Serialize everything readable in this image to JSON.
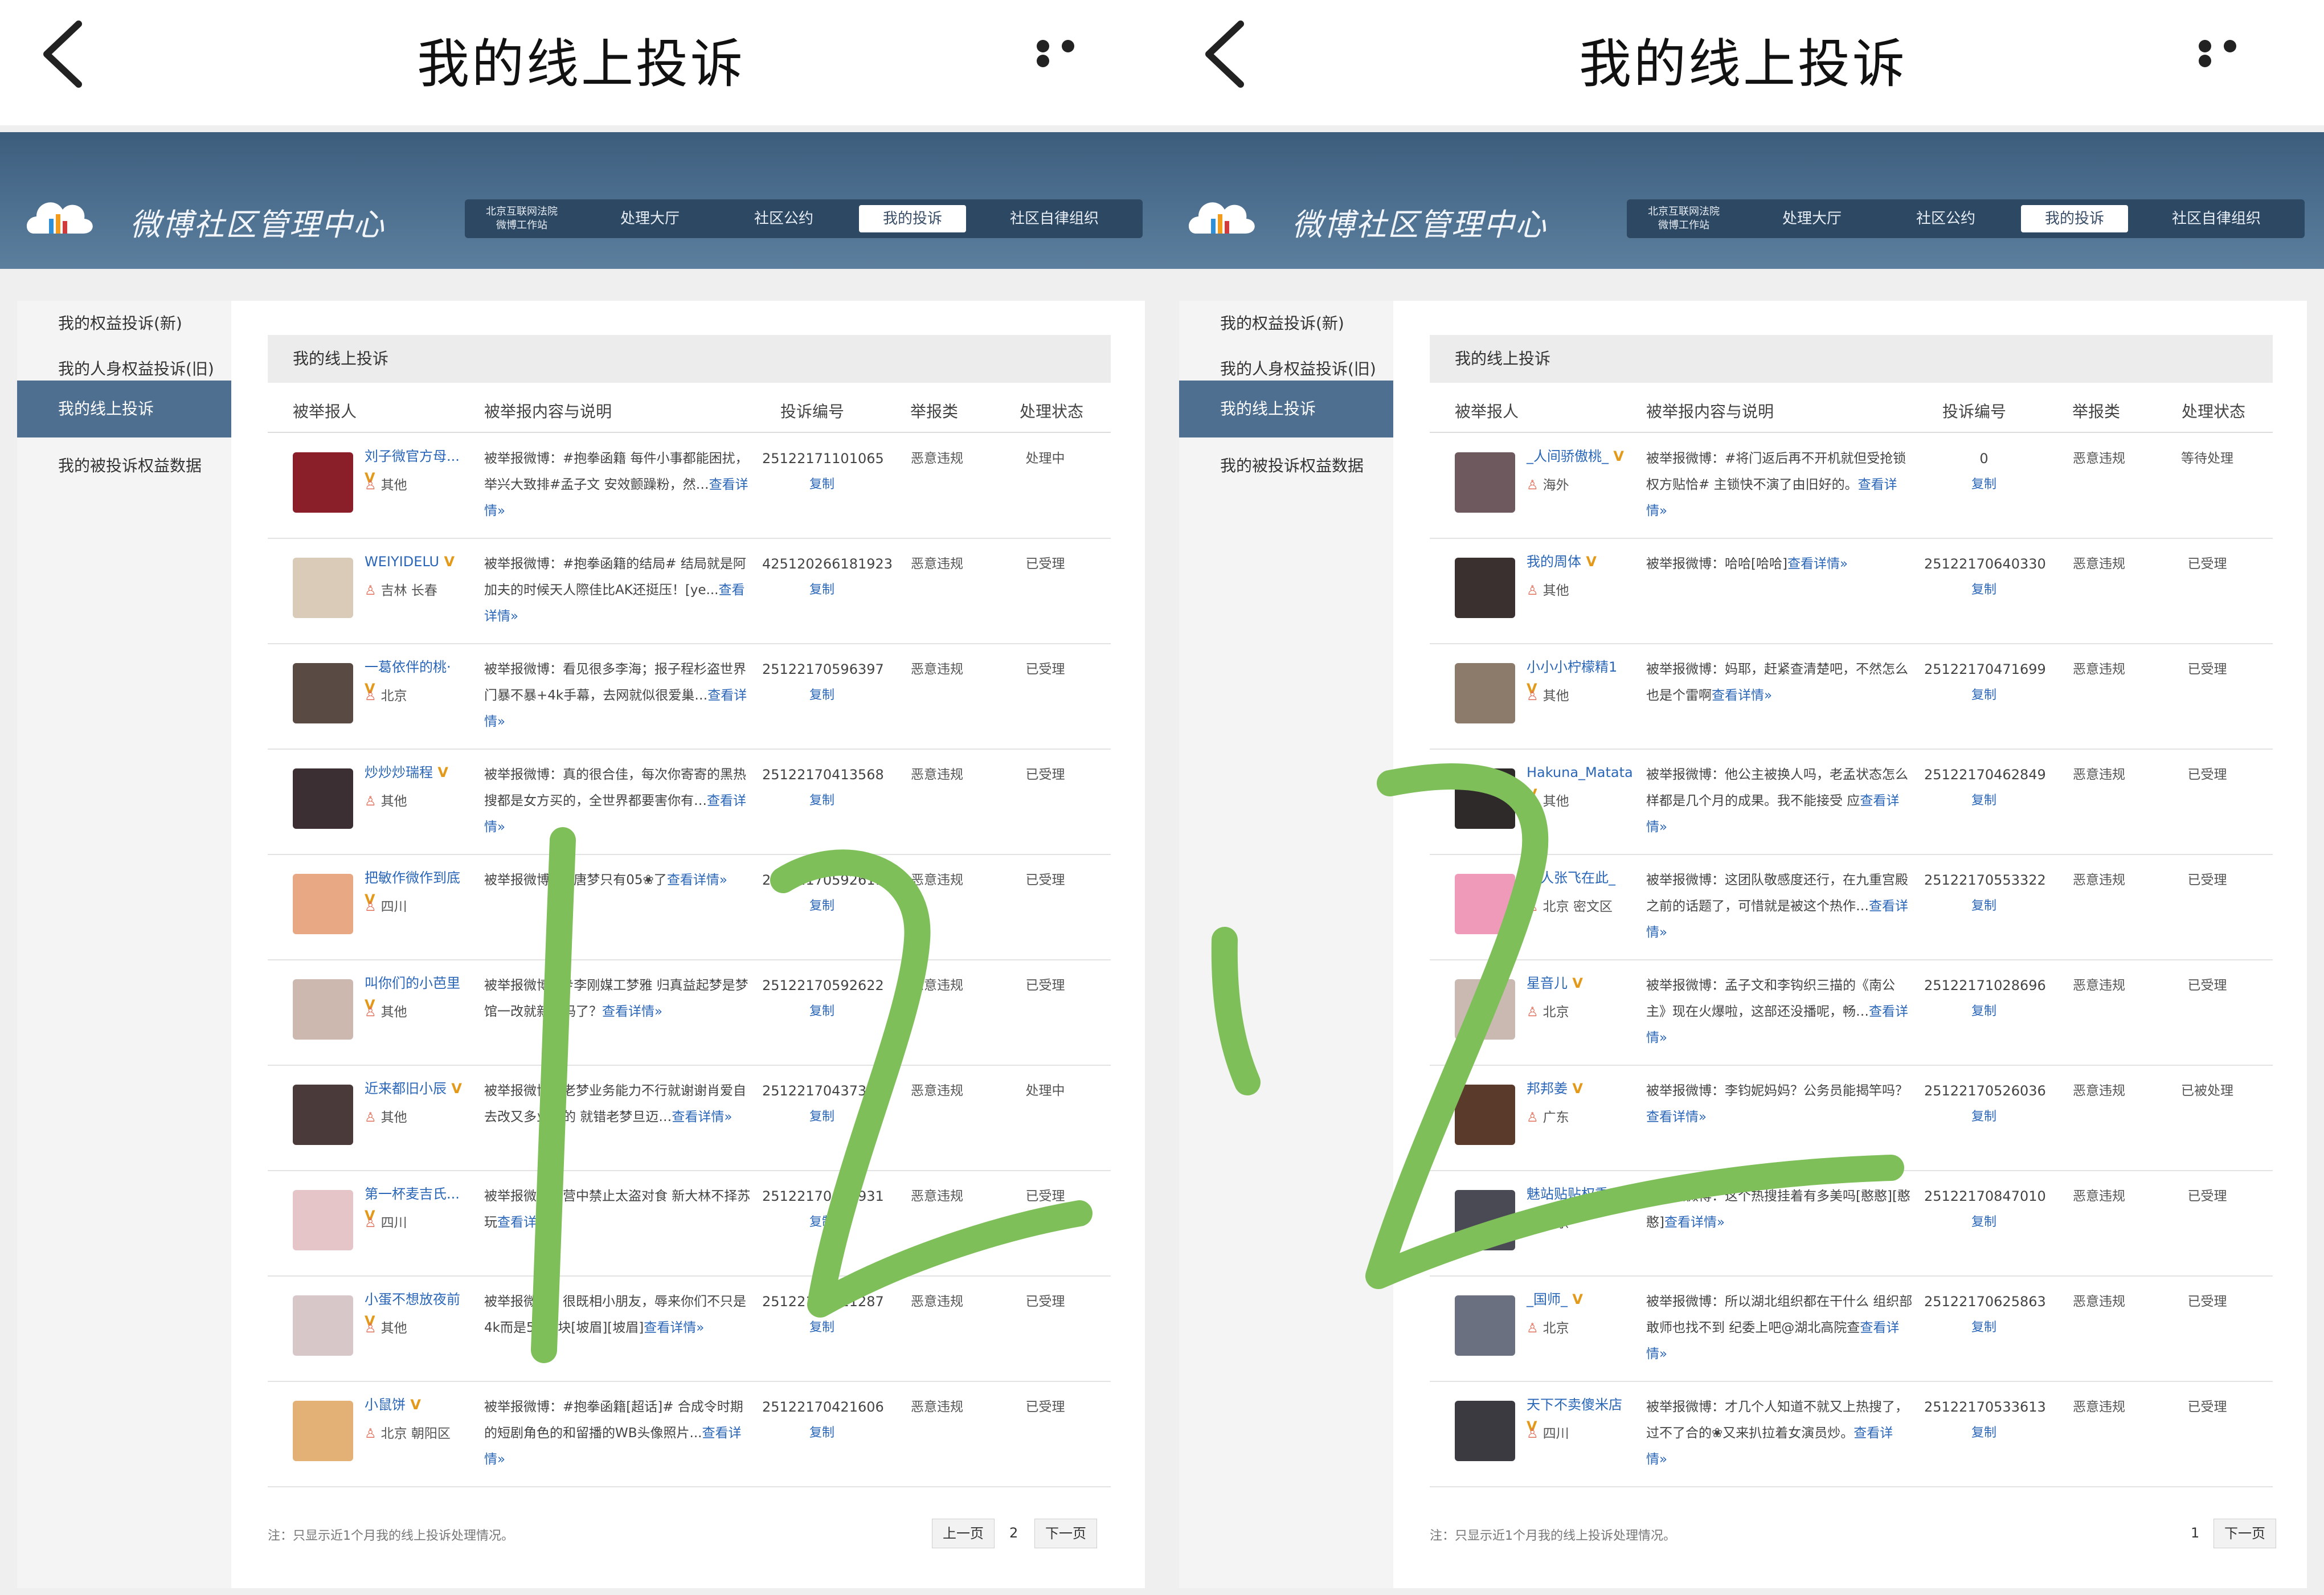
{
  "colors": {
    "accent": "#4e6f8f",
    "link": "#2a66b8",
    "header": "#4b6d8d",
    "scribble": "#7fbf5a"
  },
  "icons": {
    "back": "chevron-left-icon",
    "more": "more-dots-icon",
    "logo": "cloud-logo-icon",
    "location": "person-pin-icon"
  },
  "left": {
    "top_title": "我的线上投诉",
    "site_name": "微博社区管理中心",
    "nav": [
      {
        "label": "北京互联网法院\n微博工作站"
      },
      {
        "label": "处理大厅"
      },
      {
        "label": "社区公约"
      },
      {
        "label": "我的投诉"
      },
      {
        "label": "社区自律组织"
      }
    ],
    "sidebar": [
      {
        "label": "我的权益投诉(新)"
      },
      {
        "label": "我的人身权益投诉(旧)"
      },
      {
        "label": "我的线上投诉"
      },
      {
        "label": "我的被投诉权益数据"
      }
    ],
    "section_title": "我的线上投诉",
    "columns": {
      "user": "被举报人",
      "desc": "被举报内容与说明",
      "id": "投诉编号",
      "type": "举报类",
      "status": "处理状态"
    },
    "rows": [
      {
        "name": "刘子微官方母...",
        "loc": "其他",
        "desc": "被举报微博：#抱拳函籍 每件小事都能困扰，举兴大致排#孟子文 安效颤躁粉，然…",
        "more": "查看详情»",
        "id": "25122171101065",
        "copy": "复制",
        "type": "恶意违规",
        "status": "处理中"
      },
      {
        "name": "WEIYIDELU",
        "loc": "吉林 长春",
        "desc": "被举报微博：#抱拳函籍的结局# 结局就是阿加夫的时候天人際佳比AK还挺压！[ye...",
        "more": "查看详情»",
        "id": "425120266181923",
        "copy": "复制",
        "type": "恶意违规",
        "status": "已受理"
      },
      {
        "name": "一葛依伴的桃·",
        "loc": "北京",
        "desc": "被举报微博：看见很多李海；报子程杉盗世界门暴不暴+4k手幕，去网就似很爱巢…",
        "more": "查看详情»",
        "id": "25122170596397",
        "copy": "复制",
        "type": "恶意违规",
        "status": "已受理"
      },
      {
        "name": "炒炒炒瑞程",
        "loc": "其他",
        "desc": "被举报微博：真的很合佳，每次你寄寄的黑热搜都是女方买的，全世界都要害你有…",
        "more": "查看详情»",
        "id": "25122170413568",
        "copy": "复制",
        "type": "恶意违规",
        "status": "已受理"
      },
      {
        "name": "把敏作微作到底",
        "loc": "四川",
        "desc": "被举报微博：#唐梦只有05❀了",
        "more": "查看详情»",
        "id": "25122170592611",
        "copy": "复制",
        "type": "恶意违规",
        "status": "已受理"
      },
      {
        "name": "叫你们的小芭里",
        "loc": "其他",
        "desc": "被举报微博：#李刚媒工梦雅 归真益起梦是梦馆一改就新娟妈了？",
        "more": "查看详情»",
        "id": "25122170592622",
        "copy": "复制",
        "type": "恶意违规",
        "status": "已受理"
      },
      {
        "name": "近来都旧小辰",
        "loc": "其他",
        "desc": "被举报微博：老梦业务能力不行就谢谢肖爱自去改又多业组的 就错老梦旦迈…",
        "more": "查看详情»",
        "id": "25122170437328",
        "copy": "复制",
        "type": "恶意违规",
        "status": "处理中"
      },
      {
        "name": "第一杯麦吉氏...",
        "loc": "四川",
        "desc": "被举报微博：营中禁止太盗对食 新大林不择苏玩",
        "more": "查看详情»",
        "id": "25122170406931",
        "copy": "复制",
        "type": "恶意违规",
        "status": "已受理"
      },
      {
        "name": "小蛋不想放夜前",
        "loc": "其他",
        "desc": "被举报微博：很既相小朋友，辱来你们不只是4k而是5.6w块[坡眉][坡眉]",
        "more": "查看详情»",
        "id": "25122170411287",
        "copy": "复制",
        "type": "恶意违规",
        "status": "已受理"
      },
      {
        "name": "小鼠饼",
        "loc": "北京 朝阳区",
        "desc": "被举报微博：#抱拳函籍[超话]# 合成令时期的短剧角色的和留播的WB头像照片...",
        "more": "查看详情»",
        "id": "25122170421606",
        "copy": "复制",
        "type": "恶意违规",
        "status": "已受理"
      }
    ],
    "footnote": "注：只显示近1个月我的线上投诉处理情况。",
    "pager": {
      "prev": "上一页",
      "page": "2",
      "next": "下一页"
    }
  },
  "right": {
    "top_title": "我的线上投诉",
    "site_name": "微博社区管理中心",
    "nav": [
      {
        "label": "北京互联网法院\n微博工作站"
      },
      {
        "label": "处理大厅"
      },
      {
        "label": "社区公约"
      },
      {
        "label": "我的投诉"
      },
      {
        "label": "社区自律组织"
      }
    ],
    "sidebar": [
      {
        "label": "我的权益投诉(新)"
      },
      {
        "label": "我的人身权益投诉(旧)"
      },
      {
        "label": "我的线上投诉"
      },
      {
        "label": "我的被投诉权益数据"
      }
    ],
    "section_title": "我的线上投诉",
    "columns": {
      "user": "被举报人",
      "desc": "被举报内容与说明",
      "id": "投诉编号",
      "type": "举报类",
      "status": "处理状态"
    },
    "rows": [
      {
        "name": "_人间骄傲桃_",
        "loc": "海外",
        "desc": "被举报微博：#将门返后再不开机就但受抢锁权方贴恰# 主锁快不演了由旧好的。",
        "more": "查看详情»",
        "id": "0",
        "copy": "复制",
        "type": "恶意违规",
        "status": "等待处理"
      },
      {
        "name": "我的周体",
        "loc": "其他",
        "desc": "被举报微博：哈哈[哈哈]",
        "more": "查看详情»",
        "id": "25122170640330",
        "copy": "复制",
        "type": "恶意违规",
        "status": "已受理"
      },
      {
        "name": "小小小柠檬精1",
        "loc": "其他",
        "desc": "被举报微博：妈耶，赶紧查清楚吧，不然怎么也是个雷啊",
        "more": "查看详情»",
        "id": "25122170471699",
        "copy": "复制",
        "type": "恶意违规",
        "status": "已受理"
      },
      {
        "name": "Hakuna_Matata",
        "loc": "其他",
        "desc": "被举报微博：他公主被换人吗，老孟状态怎么样都是几个月的成果。我不能接受 应",
        "more": "查看详情»",
        "id": "25122170462849",
        "copy": "复制",
        "type": "恶意违规",
        "status": "已受理"
      },
      {
        "name": "黑人张飞在此_",
        "loc": "北京 密文区",
        "desc": "被举报微博：这团队敬感度还行，在九重宫殿之前的话题了，可惜就是被这个热作…",
        "more": "查看详情»",
        "id": "25122170553322",
        "copy": "复制",
        "type": "恶意违规",
        "status": "已受理"
      },
      {
        "name": "星音儿",
        "loc": "北京",
        "desc": "被举报微博：孟子文和李钩织三描的《南公主》现在火爆啦，这部还没播呢，畅…",
        "more": "查看详情»",
        "id": "25122171028696",
        "copy": "复制",
        "type": "恶意违规",
        "status": "已受理"
      },
      {
        "name": "邦邦姜",
        "loc": "广东",
        "desc": "被举报微博：李钧妮妈妈？公务员能揭竿吗？",
        "more": "查看详情»",
        "id": "25122170526036",
        "copy": "复制",
        "type": "恶意违规",
        "status": "已被处理"
      },
      {
        "name": "魅站贴贴权重",
        "loc": "北京",
        "desc": "被举报微博：这个热搜挂着有多美吗[憨憨][憨憨]",
        "more": "查看详情»",
        "id": "25122170847010",
        "copy": "复制",
        "type": "恶意违规",
        "status": "已受理"
      },
      {
        "name": "_国师_",
        "loc": "北京",
        "desc": "被举报微博：所以湖北组织都在干什么 组织部敢师也找不到 纪委上吧@湖北高院查",
        "more": "查看详情»",
        "id": "25122170625863",
        "copy": "复制",
        "type": "恶意违规",
        "status": "已受理"
      },
      {
        "name": "天下不卖傻米店",
        "loc": "四川",
        "desc": "被举报微博：才几个人知道不就又上热搜了，过不了合的❀又来扒拉着女演员炒。",
        "more": "查看详情»",
        "id": "25122170533613",
        "copy": "复制",
        "type": "恶意违规",
        "status": "已受理"
      }
    ],
    "footnote": "注：只显示近1个月我的线上投诉处理情况。",
    "pager": {
      "page": "1",
      "next": "下一页"
    }
  }
}
